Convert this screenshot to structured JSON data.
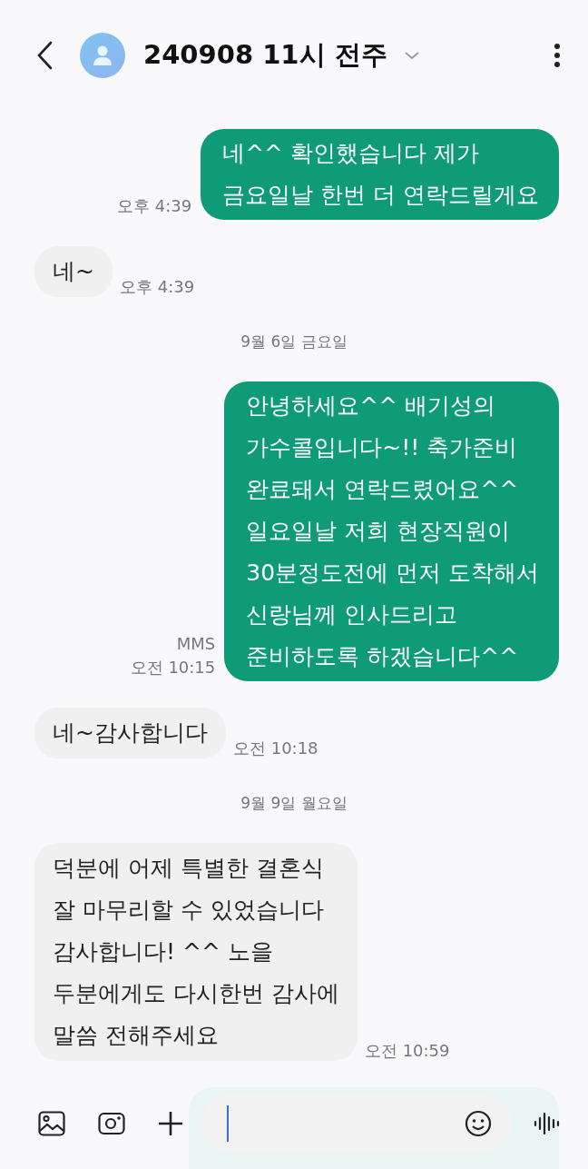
{
  "header": {
    "title": "240908 11시 전주"
  },
  "messages": [
    {
      "kind": "sent",
      "text": "네^^ 확인했습니다 제가\n금요일날 한번 더 연락드릴게요",
      "time": "오후 4:39"
    },
    {
      "kind": "received",
      "text": "네~",
      "time": "오후 4:39"
    },
    {
      "kind": "date",
      "text": "9월 6일 금요일"
    },
    {
      "kind": "sent",
      "text": "안녕하세요^^ 배기성의\n가수콜입니다~!! 축가준비\n완료돼서 연락드렸어요^^\n일요일날 저희 현장직원이\n30분정도전에 먼저 도착해서\n신랑님께 인사드리고\n준비하도록 하겠습니다^^",
      "type": "MMS",
      "time": "오전 10:15"
    },
    {
      "kind": "received",
      "text": "네~감사합니다",
      "time": "오전 10:18"
    },
    {
      "kind": "date",
      "text": "9월 9일 월요일"
    },
    {
      "kind": "received",
      "text": "덕분에 어제 특별한 결혼식\n잘 마무리할 수 있었습니다\n감사합니다! ^^ 노을\n두분에게도 다시한번 감사에\n말씀 전해주세요",
      "time": "오전 10:59"
    },
    {
      "kind": "partial"
    }
  ]
}
